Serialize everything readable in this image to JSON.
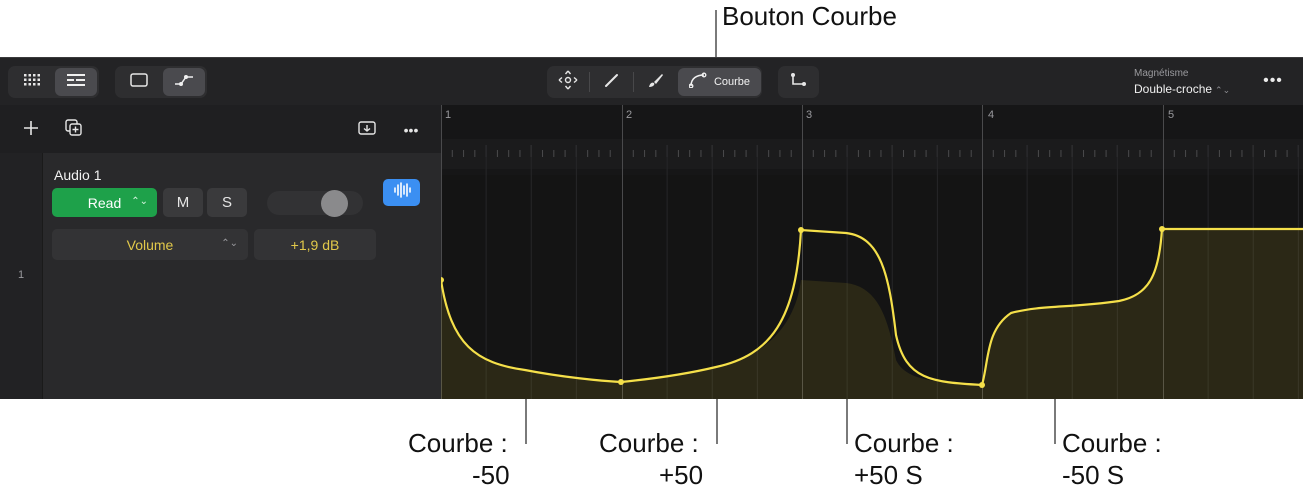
{
  "callouts": {
    "top": "Bouton Courbe",
    "c1_line1": "Courbe :",
    "c1_line2": "-50",
    "c2_line1": "Courbe :",
    "c2_line2": "+50",
    "c3_line1": "Courbe :",
    "c3_line2": "+50 S",
    "c4_line1": "Courbe :",
    "c4_line2": "-50 S"
  },
  "toolbar": {
    "left_icons": [
      "grid-view-icon",
      "list-view-icon",
      "window-icon",
      "automation-icon"
    ],
    "tools": [
      {
        "icon": "pointer-move-icon",
        "label": ""
      },
      {
        "icon": "pencil-icon",
        "label": ""
      },
      {
        "icon": "brush-icon",
        "label": ""
      },
      {
        "icon": "curve-icon",
        "label": "Courbe",
        "active": true
      }
    ],
    "extra_tool_icon": "corner-line-icon",
    "snap_label": "Magnétisme",
    "snap_value": "Double-croche",
    "more_icon": "ellipsis-icon"
  },
  "header_tools": {
    "add_icon": "plus-icon",
    "duplicate_icon": "duplicate-icon",
    "import_icon": "import-tray-icon",
    "more_icon": "ellipsis-icon"
  },
  "track": {
    "number": "1",
    "name": "Audio 1",
    "automation_mode": "Read",
    "mute": "M",
    "solo": "S",
    "parameter": "Volume",
    "parameter_value": "+1,9 dB"
  },
  "ruler": {
    "bars": [
      "1",
      "2",
      "3",
      "4",
      "5"
    ]
  },
  "colors": {
    "automation_line": "#f5e04a",
    "read_button": "#1ea14a",
    "waveform_button": "#3b8ff2",
    "value_text": "#e2c94a",
    "background": "#1c1c1e"
  }
}
